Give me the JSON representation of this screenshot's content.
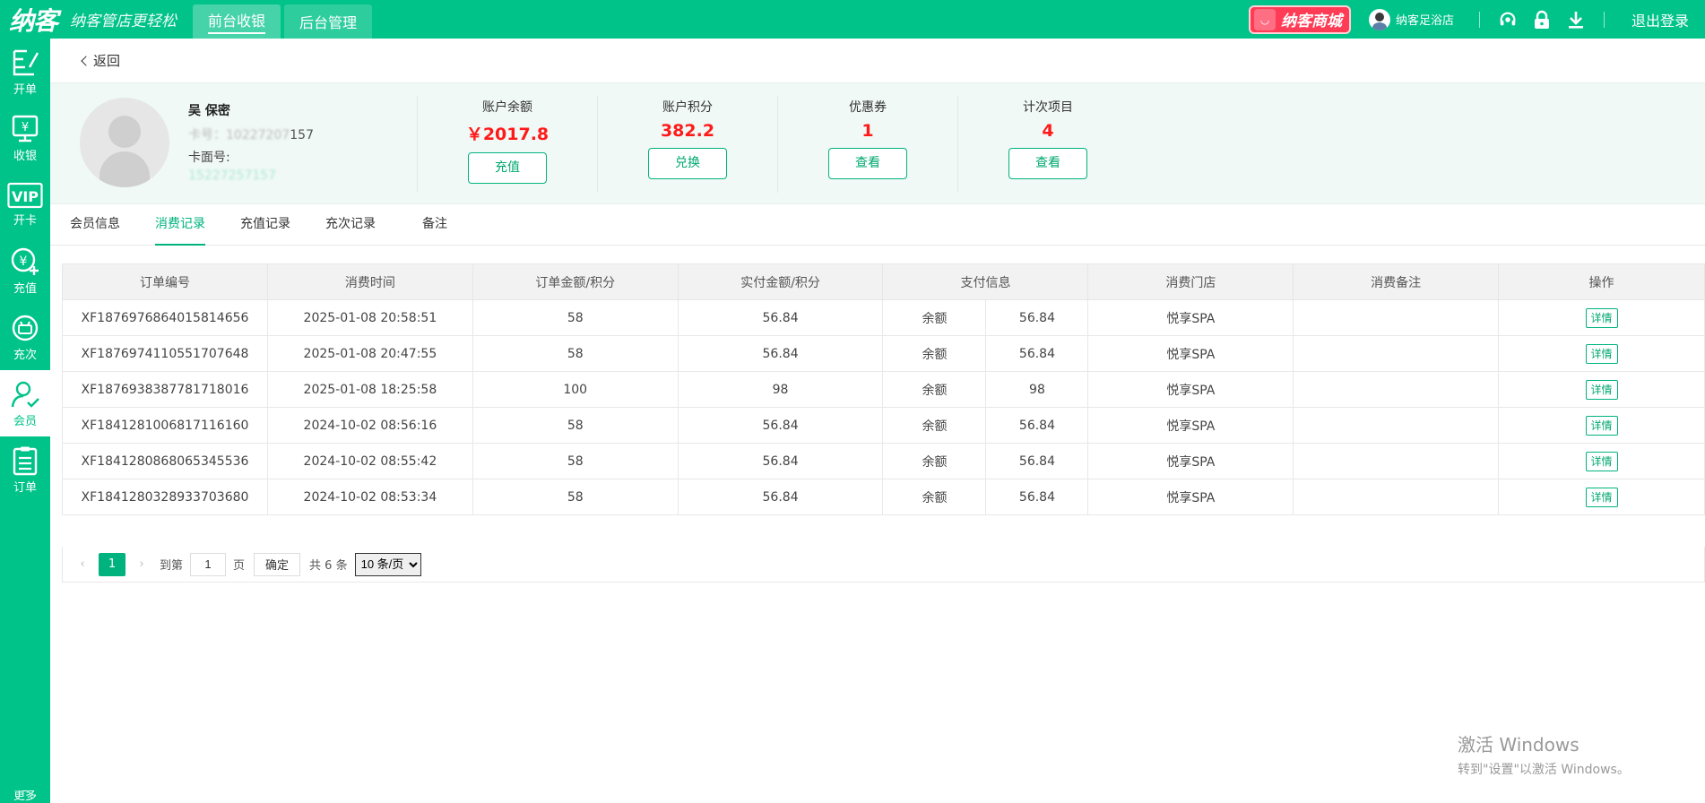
{
  "app": {
    "logo": "纳客",
    "slogan": "纳客管店更轻松",
    "tabs": [
      {
        "label": "前台收银",
        "active": true
      },
      {
        "label": "后台管理",
        "active": false
      }
    ],
    "mall": "纳客商城",
    "store": "纳客足浴店",
    "logout": "退出登录",
    "icons": [
      "headset-icon",
      "lock-icon",
      "download-icon"
    ],
    "accent": "#00c389"
  },
  "sidebar": {
    "items": [
      {
        "label": "开单",
        "icon": "order-icon"
      },
      {
        "label": "收银",
        "icon": "cashier-icon"
      },
      {
        "label": "开卡",
        "icon": "vip-icon"
      },
      {
        "label": "充值",
        "icon": "recharge-icon"
      },
      {
        "label": "充次",
        "icon": "times-icon"
      },
      {
        "label": "会员",
        "icon": "member-icon",
        "active": true
      },
      {
        "label": "订单",
        "icon": "list-icon"
      }
    ],
    "more": "更多"
  },
  "back": "返回",
  "member": {
    "name": "吴 保密",
    "card_prefix": "卡号：",
    "card_masked": "10227207",
    "card_suffix": "157",
    "face_label": "卡面号:",
    "phone_masked": "15227257157"
  },
  "stats": [
    {
      "label": "账户余额",
      "value": "￥2017.8",
      "button": "充值"
    },
    {
      "label": "账户积分",
      "value": "382.2",
      "button": "兑换"
    },
    {
      "label": "优惠券",
      "value": "1",
      "button": "查看"
    },
    {
      "label": "计次项目",
      "value": "4",
      "button": "查看"
    }
  ],
  "tabs": [
    {
      "label": "会员信息",
      "active": false
    },
    {
      "label": "消费记录",
      "active": true
    },
    {
      "label": "充值记录",
      "active": false
    },
    {
      "label": "充次记录",
      "active": false
    },
    {
      "label": "备注",
      "active": false
    }
  ],
  "table": {
    "headers": [
      "订单编号",
      "消费时间",
      "订单金额/积分",
      "实付金额/积分",
      "支付信息",
      "消费门店",
      "消费备注",
      "操作"
    ],
    "rows": [
      {
        "id": "XF1876976864015814656",
        "time": "2025-01-08 20:58:51",
        "amount": "58",
        "paid": "56.84",
        "pay_type": "余额",
        "pay_value": "56.84",
        "store": "悦享SPA",
        "remark": "",
        "action": "详情"
      },
      {
        "id": "XF1876974110551707648",
        "time": "2025-01-08 20:47:55",
        "amount": "58",
        "paid": "56.84",
        "pay_type": "余额",
        "pay_value": "56.84",
        "store": "悦享SPA",
        "remark": "",
        "action": "详情"
      },
      {
        "id": "XF1876938387781718016",
        "time": "2025-01-08 18:25:58",
        "amount": "100",
        "paid": "98",
        "pay_type": "余额",
        "pay_value": "98",
        "store": "悦享SPA",
        "remark": "",
        "action": "详情"
      },
      {
        "id": "XF1841281006817116160",
        "time": "2024-10-02 08:56:16",
        "amount": "58",
        "paid": "56.84",
        "pay_type": "余额",
        "pay_value": "56.84",
        "store": "悦享SPA",
        "remark": "",
        "action": "详情"
      },
      {
        "id": "XF1841280868065345536",
        "time": "2024-10-02 08:55:42",
        "amount": "58",
        "paid": "56.84",
        "pay_type": "余额",
        "pay_value": "56.84",
        "store": "悦享SPA",
        "remark": "",
        "action": "详情"
      },
      {
        "id": "XF1841280328933703680",
        "time": "2024-10-02 08:53:34",
        "amount": "58",
        "paid": "56.84",
        "pay_type": "余额",
        "pay_value": "56.84",
        "store": "悦享SPA",
        "remark": "",
        "action": "详情"
      }
    ]
  },
  "pager": {
    "current": "1",
    "goto_label": "到第",
    "goto_value": "1",
    "page_unit": "页",
    "confirm": "确定",
    "total": "共 6 条",
    "page_size": "10 条/页"
  },
  "watermark": {
    "line1": "激活 Windows",
    "line2": "转到\"设置\"以激活 Windows。"
  }
}
